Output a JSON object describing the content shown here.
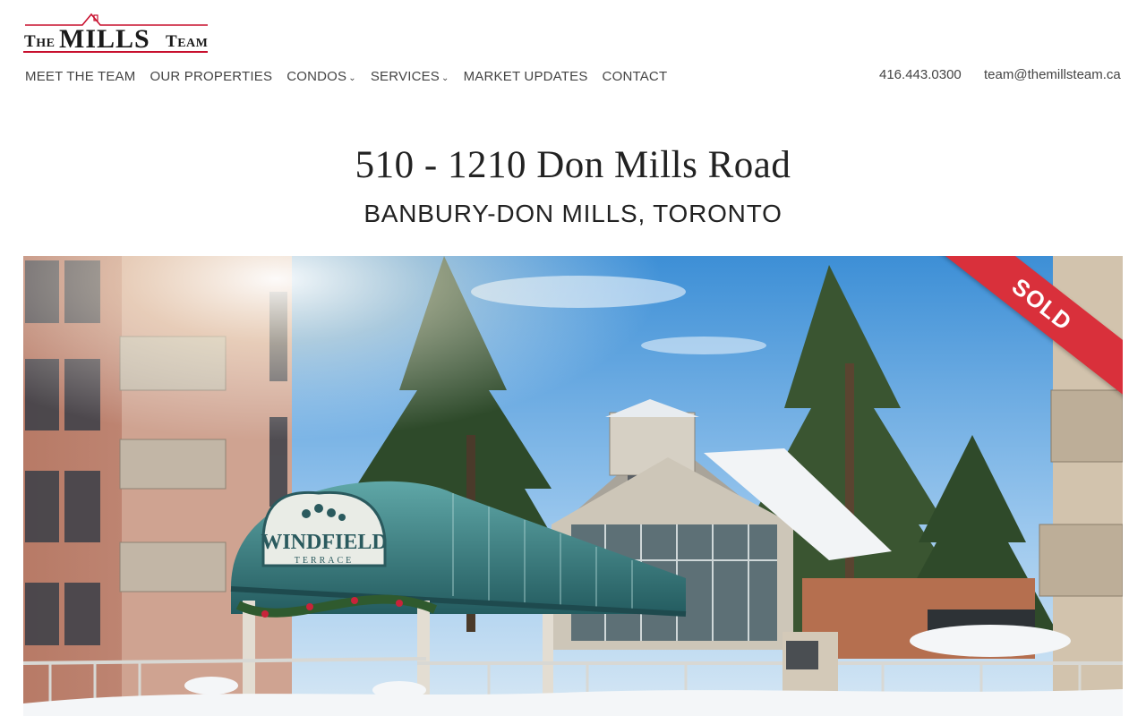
{
  "brand": {
    "logo_text": "THE MILLS TEAM",
    "accent_color": "#c8102e"
  },
  "nav": {
    "items": [
      {
        "label": "MEET THE TEAM",
        "has_dropdown": false
      },
      {
        "label": "OUR PROPERTIES",
        "has_dropdown": false
      },
      {
        "label": "CONDOS",
        "has_dropdown": true
      },
      {
        "label": "SERVICES",
        "has_dropdown": true
      },
      {
        "label": "MARKET UPDATES",
        "has_dropdown": false
      },
      {
        "label": "CONTACT",
        "has_dropdown": false
      }
    ],
    "dropdown_icon": "chevron-down-icon"
  },
  "contact": {
    "phone": "416.443.0300",
    "email": "team@themillsteam.ca"
  },
  "listing": {
    "address": "510 - 1210 Don Mills Road",
    "area": "BANBURY-DON MILLS, TORONTO",
    "status": "SOLD",
    "status_color": "#d9303b",
    "sign_text": "WINDFIELD",
    "sign_subtext": "TERRACE"
  }
}
